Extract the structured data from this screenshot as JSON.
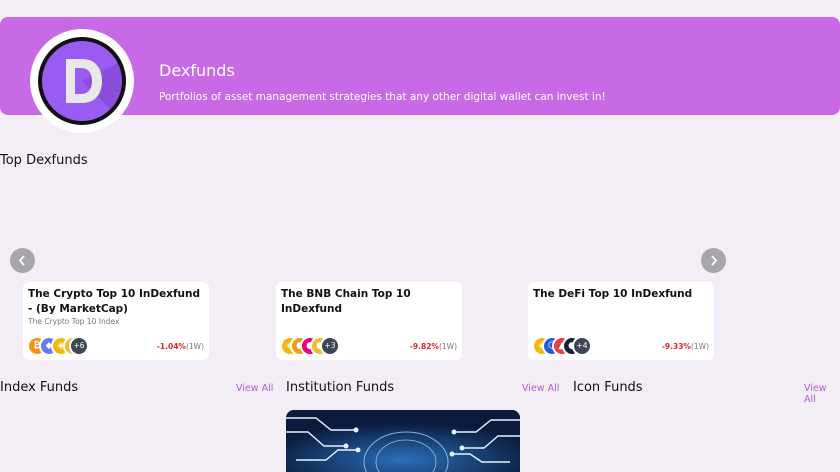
{
  "header": {
    "title": "Dexfunds",
    "subtitle": "Portfolios of asset management strategies that any other digital wallet can invest in!",
    "logo_letter": "D"
  },
  "top_section": {
    "title": "Top Dexfunds",
    "prev_icon": "chevron-left-icon",
    "next_icon": "chevron-right-icon",
    "cards": [
      {
        "title": "The Crypto Top 10 InDexfund - (By MarketCap)",
        "subtitle": "The Crypto Top 10 Index",
        "more_count": "+6",
        "change": "-1.04%",
        "period": "(1W)",
        "coin_colors": [
          "#f7931a",
          "#627eea",
          "#f0b90b",
          "#f3ba2f"
        ]
      },
      {
        "title": "The BNB Chain Top 10 InDexfund",
        "subtitle": "",
        "more_count": "+3",
        "change": "-9.82%",
        "period": "(1W)",
        "coin_colors": [
          "#f0b90b",
          "#e8a21a",
          "#e6007a",
          "#f3ba2f"
        ]
      },
      {
        "title": "The DeFi Top 10 InDexfund",
        "subtitle": "",
        "more_count": "+4",
        "change": "-9.33%",
        "period": "(1W)",
        "coin_colors": [
          "#f0b90b",
          "#2a5ada",
          "#e84142",
          "#1a1f36"
        ]
      }
    ]
  },
  "columns": [
    {
      "title": "Index Funds",
      "view_all": "View All"
    },
    {
      "title": "Institution Funds",
      "view_all": "View All"
    },
    {
      "title": "Icon Funds",
      "view_all": "View All"
    }
  ],
  "colors": {
    "banner": "#c86ae6",
    "accent": "#b45ad9",
    "negative": "#e0242a"
  }
}
